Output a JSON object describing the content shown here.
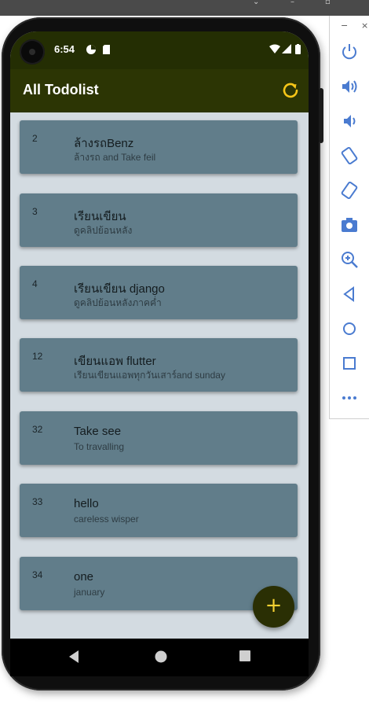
{
  "status": {
    "time": "6:54"
  },
  "app": {
    "title": "All Todolist"
  },
  "todos": [
    {
      "id": "2",
      "title": "ล้างรถBenz",
      "subtitle": "ล้างรถ and Take feil"
    },
    {
      "id": "3",
      "title": "เรียนเขียน",
      "subtitle": "ดูคลิปย้อนหลัง"
    },
    {
      "id": "4",
      "title": "เรียนเขียน django",
      "subtitle": "ดูคลิปย้อนหลังภาคค่ำ"
    },
    {
      "id": "12",
      "title": "เขียนแอพ flutter",
      "subtitle": "เรียนเขียนแอพทุกวันเสาร์and sunday"
    },
    {
      "id": "32",
      "title": "Take see",
      "subtitle": "To travalling"
    },
    {
      "id": "33",
      "title": "hello",
      "subtitle": "careless wisper"
    },
    {
      "id": "34",
      "title": "one",
      "subtitle": "january"
    }
  ],
  "fab": {
    "symbol": "+"
  },
  "colors": {
    "status_bar": "#242e03",
    "app_bar": "#2c3504",
    "accent": "#f5d132",
    "card": "#617d8a",
    "background": "#d3dbe1"
  },
  "icons": {
    "refresh": "refresh-icon",
    "wifi": "wifi-icon",
    "signal": "signal-icon",
    "battery": "battery-icon",
    "back": "back-icon",
    "home": "home-icon",
    "recents": "recents-icon"
  },
  "emulator_toolbar": {
    "window_controls": [
      "−",
      "×"
    ],
    "buttons": [
      "power",
      "volume-up",
      "volume-down",
      "rotate-left",
      "rotate-right",
      "screenshot",
      "zoom",
      "back",
      "home",
      "overview",
      "more"
    ]
  }
}
